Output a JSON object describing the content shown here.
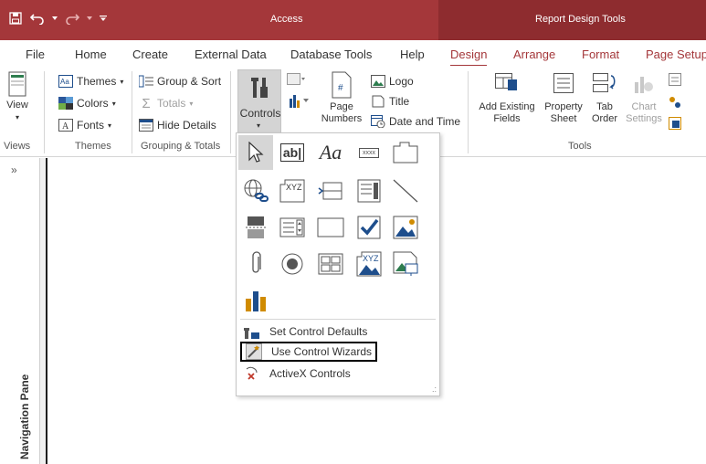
{
  "titlebar": {
    "app_title": "Access",
    "context_title": "Report Design Tools"
  },
  "tabs": [
    {
      "label": "File"
    },
    {
      "label": "Home"
    },
    {
      "label": "Create"
    },
    {
      "label": "External Data"
    },
    {
      "label": "Database Tools"
    },
    {
      "label": "Help"
    },
    {
      "label": "Design"
    },
    {
      "label": "Arrange"
    },
    {
      "label": "Format"
    },
    {
      "label": "Page Setup"
    }
  ],
  "ribbon": {
    "views": {
      "view_label": "View",
      "group": "Views"
    },
    "themes": {
      "themes": "Themes",
      "colors": "Colors",
      "fonts": "Fonts",
      "group": "Themes"
    },
    "grouping": {
      "group_sort": "Group & Sort",
      "totals": "Totals",
      "hide_details": "Hide Details",
      "group": "Grouping & Totals"
    },
    "controls": {
      "label": "Controls"
    },
    "header": {
      "logo": "Logo",
      "title": "Title",
      "date_time": "Date and Time",
      "page": "Page",
      "numbers": "Numbers"
    },
    "tools": {
      "add_existing": "Add Existing",
      "fields": "Fields",
      "property": "Property",
      "sheet": "Sheet",
      "tab": "Tab",
      "order": "Order",
      "chart": "Chart",
      "settings": "Settings",
      "group": "Tools"
    }
  },
  "navpane": {
    "label": "Navigation Pane",
    "chevron": "»"
  },
  "dropdown": {
    "text_box_glyph": "ab|",
    "label_glyph": "Aa",
    "button_glyph": "xxxx",
    "items": [
      {
        "label": "Set Control Defaults"
      },
      {
        "label": "Use Control Wizards"
      },
      {
        "label": "ActiveX Controls"
      }
    ]
  }
}
